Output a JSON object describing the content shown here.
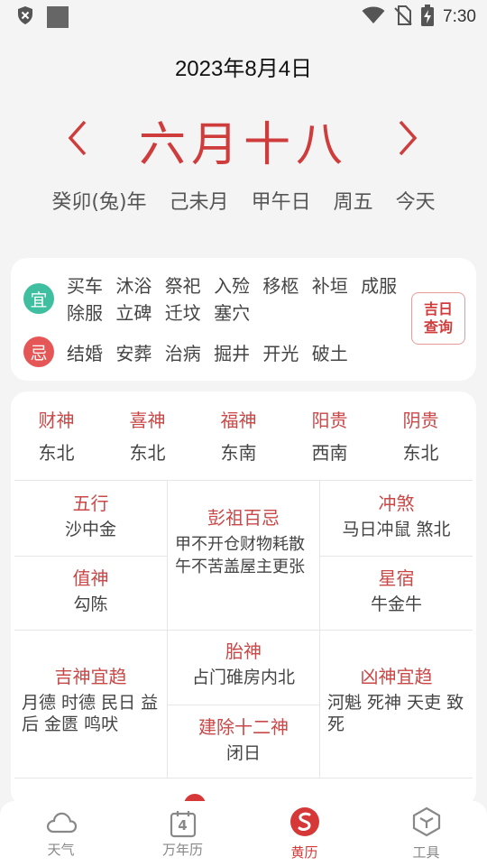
{
  "status_bar": {
    "time": "7:30",
    "icons_left": [
      "shield-icon",
      "square-icon"
    ],
    "icons_right": [
      "wifi-icon",
      "no-sim-icon",
      "battery-charging-icon"
    ]
  },
  "header": {
    "date": "2023年8月4日",
    "lunar_date": "六月十八",
    "ganzhi": [
      "癸卯(兔)年",
      "己未月",
      "甲午日",
      "周五",
      "今天"
    ]
  },
  "yiji": {
    "yi_label": "宜",
    "yi_text": "买车 沐浴 祭祀 入殓 移柩 补垣 成服 除服 立碑 迁坟 塞穴",
    "ji_label": "忌",
    "ji_text": "结婚 安葬 治病 掘井 开光 破土",
    "button_line1": "吉日",
    "button_line2": "查询"
  },
  "gods": [
    {
      "name": "财神",
      "dir": "东北"
    },
    {
      "name": "喜神",
      "dir": "东北"
    },
    {
      "name": "福神",
      "dir": "东南"
    },
    {
      "name": "阳贵",
      "dir": "西南"
    },
    {
      "name": "阴贵",
      "dir": "东北"
    }
  ],
  "details": {
    "wuxing": {
      "title": "五行",
      "value": "沙中金"
    },
    "pengzu": {
      "title": "彭祖百忌",
      "value": "甲不开仓财物耗散 午不苦盖屋主更张"
    },
    "chongsha": {
      "title": "冲煞",
      "value": "马日冲鼠 煞北"
    },
    "zhishen": {
      "title": "值神",
      "value": "勾陈"
    },
    "xingxiu": {
      "title": "星宿",
      "value": "牛金牛"
    },
    "jishen": {
      "title": "吉神宜趋",
      "value": "月德 时德 民日 益后 金匮 鸣吠"
    },
    "taishen": {
      "title": "胎神",
      "value": "占门碓房内北"
    },
    "jianchu": {
      "title": "建除十二神",
      "value": "闭日"
    },
    "xiongshen": {
      "title": "凶神宜趋",
      "value": "河魁 死神 天吏 致死"
    }
  },
  "tabs": [
    {
      "label": "天气",
      "icon": "cloud-icon",
      "active": false
    },
    {
      "label": "万年历",
      "icon": "calendar-icon",
      "active": false,
      "badge": "4"
    },
    {
      "label": "黄历",
      "icon": "huangli-icon",
      "active": true
    },
    {
      "label": "工具",
      "icon": "toolbox-icon",
      "active": false
    }
  ],
  "colors": {
    "accent_red": "#cf3c3c",
    "yi_green": "#3fbf9f",
    "ji_red": "#e55757"
  }
}
